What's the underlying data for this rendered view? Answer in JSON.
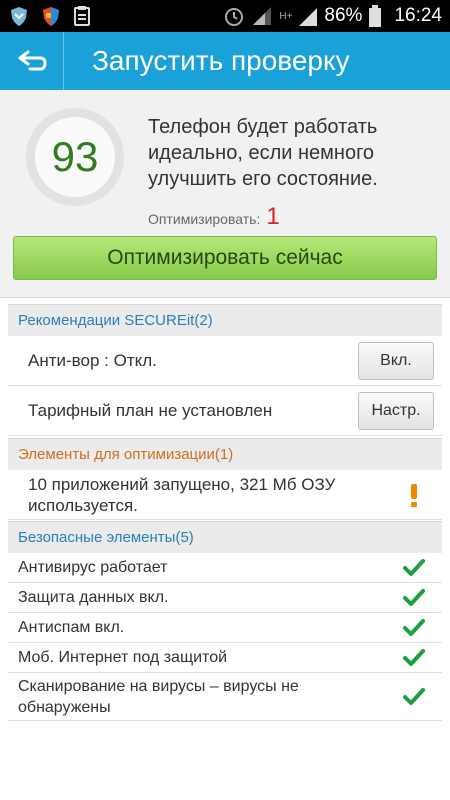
{
  "status_bar": {
    "battery": "86%",
    "time": "16:24",
    "network": "H+"
  },
  "header": {
    "title": "Запустить проверку"
  },
  "summary": {
    "score": "93",
    "message": "Телефон будет работать идеально, если немного улучшить его состояние.",
    "optimize_label": "Оптимизировать:",
    "optimize_count": "1",
    "optimize_button": "Оптимизировать сейчас"
  },
  "recommendations": {
    "title": "Рекомендации SECUREit(2)",
    "items": [
      {
        "text": "Анти-вор : Откл.",
        "button": "Вкл."
      },
      {
        "text": "Тарифный план не установлен",
        "button": "Настр."
      }
    ]
  },
  "optimization": {
    "title": "Элементы для оптимизации(1)",
    "items": [
      {
        "text": "10 приложений запущено, 321 Мб ОЗУ используется.",
        "icon": "warning-icon"
      }
    ]
  },
  "safe": {
    "title": "Безопасные элементы(5)",
    "items": [
      {
        "text": "Антивирус работает",
        "icon": "check-icon"
      },
      {
        "text": "Защита данных  вкл.",
        "icon": "check-icon"
      },
      {
        "text": "Антиспам  вкл.",
        "icon": "check-icon"
      },
      {
        "text": "Моб. Интернет  под защитой",
        "icon": "check-icon"
      },
      {
        "text": "Сканирование на вирусы – вирусы не обнаружены",
        "icon": "check-icon"
      }
    ]
  },
  "colors": {
    "header": "#1aa1d8",
    "score": "#2e7d1f",
    "accent_green": "#88c94a",
    "check": "#1e9e3e",
    "warning": "#ef8a00",
    "section_blue": "#2a7fb8",
    "section_orange": "#d0701f"
  }
}
